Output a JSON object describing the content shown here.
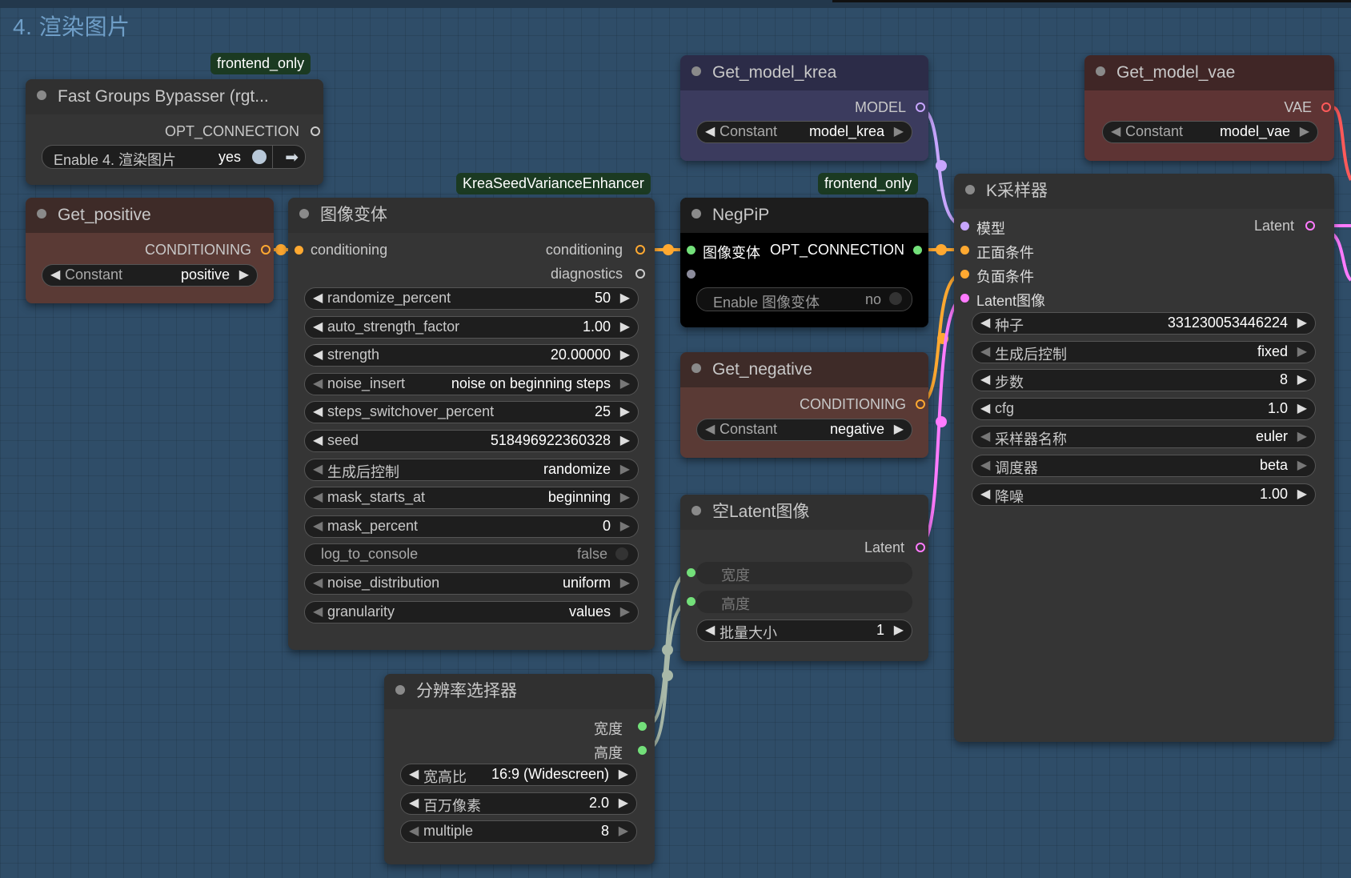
{
  "group": {
    "title": "4. 渲染图片"
  },
  "tags": {
    "frontend_only_1": "frontend_only",
    "krea_enhancer": "KreaSeedVarianceEnhancer",
    "frontend_only_2": "frontend_only"
  },
  "fast_groups": {
    "title": "Fast Groups Bypasser (rgt...",
    "output": "OPT_CONNECTION",
    "toggle_label": "Enable 4. 渲染图片",
    "toggle_value": "yes"
  },
  "get_positive": {
    "title": "Get_positive",
    "output": "CONDITIONING",
    "widget_label": "Constant",
    "widget_value": "positive"
  },
  "image_variant": {
    "title": "图像变体",
    "input": "conditioning",
    "outputs": [
      "conditioning",
      "diagnostics"
    ],
    "widgets": [
      {
        "label": "randomize_percent",
        "value": "50"
      },
      {
        "label": "auto_strength_factor",
        "value": "1.00"
      },
      {
        "label": "strength",
        "value": "20.00000"
      },
      {
        "label": "noise_insert",
        "value": "noise on beginning steps"
      },
      {
        "label": "steps_switchover_percent",
        "value": "25"
      },
      {
        "label": "seed",
        "value": "518496922360328"
      },
      {
        "label": "生成后控制",
        "value": "randomize"
      },
      {
        "label": "mask_starts_at",
        "value": "beginning"
      },
      {
        "label": "mask_percent",
        "value": "0"
      },
      {
        "label": "log_to_console",
        "value": "false"
      },
      {
        "label": "noise_distribution",
        "value": "uniform"
      },
      {
        "label": "granularity",
        "value": "values"
      }
    ]
  },
  "get_model_krea": {
    "title": "Get_model_krea",
    "output": "MODEL",
    "widget_label": "Constant",
    "widget_value": "model_krea"
  },
  "negpip": {
    "title": "NegPiP",
    "input": "图像变体",
    "output": "OPT_CONNECTION",
    "toggle_label": "Enable 图像变体",
    "toggle_value": "no"
  },
  "get_negative": {
    "title": "Get_negative",
    "output": "CONDITIONING",
    "widget_label": "Constant",
    "widget_value": "negative"
  },
  "empty_latent": {
    "title": "空Latent图像",
    "output": "Latent",
    "inputs": [
      "宽度",
      "高度"
    ],
    "batch_label": "批量大小",
    "batch_value": "1"
  },
  "resolution": {
    "title": "分辨率选择器",
    "outputs": [
      "宽度",
      "高度"
    ],
    "widgets": [
      {
        "label": "宽高比",
        "value": "16:9 (Widescreen)"
      },
      {
        "label": "百万像素",
        "value": "2.0"
      },
      {
        "label": "multiple",
        "value": "8"
      }
    ]
  },
  "get_model_vae": {
    "title": "Get_model_vae",
    "output": "VAE",
    "widget_label": "Constant",
    "widget_value": "model_vae"
  },
  "ksampler": {
    "title": "K采样器",
    "inputs": [
      "模型",
      "正面条件",
      "负面条件",
      "Latent图像"
    ],
    "output": "Latent",
    "widgets": [
      {
        "label": "种子",
        "value": "331230053446224"
      },
      {
        "label": "生成后控制",
        "value": "fixed"
      },
      {
        "label": "步数",
        "value": "8"
      },
      {
        "label": "cfg",
        "value": "1.0"
      },
      {
        "label": "采样器名称",
        "value": "euler"
      },
      {
        "label": "调度器",
        "value": "beta"
      },
      {
        "label": "降噪",
        "value": "1.00"
      }
    ]
  },
  "colors": {
    "conditioning": "#ffa931",
    "latent": "#ff7bff",
    "model": "#c8a6ff",
    "int": "#73e07a",
    "vae": "#ff5a5a"
  }
}
